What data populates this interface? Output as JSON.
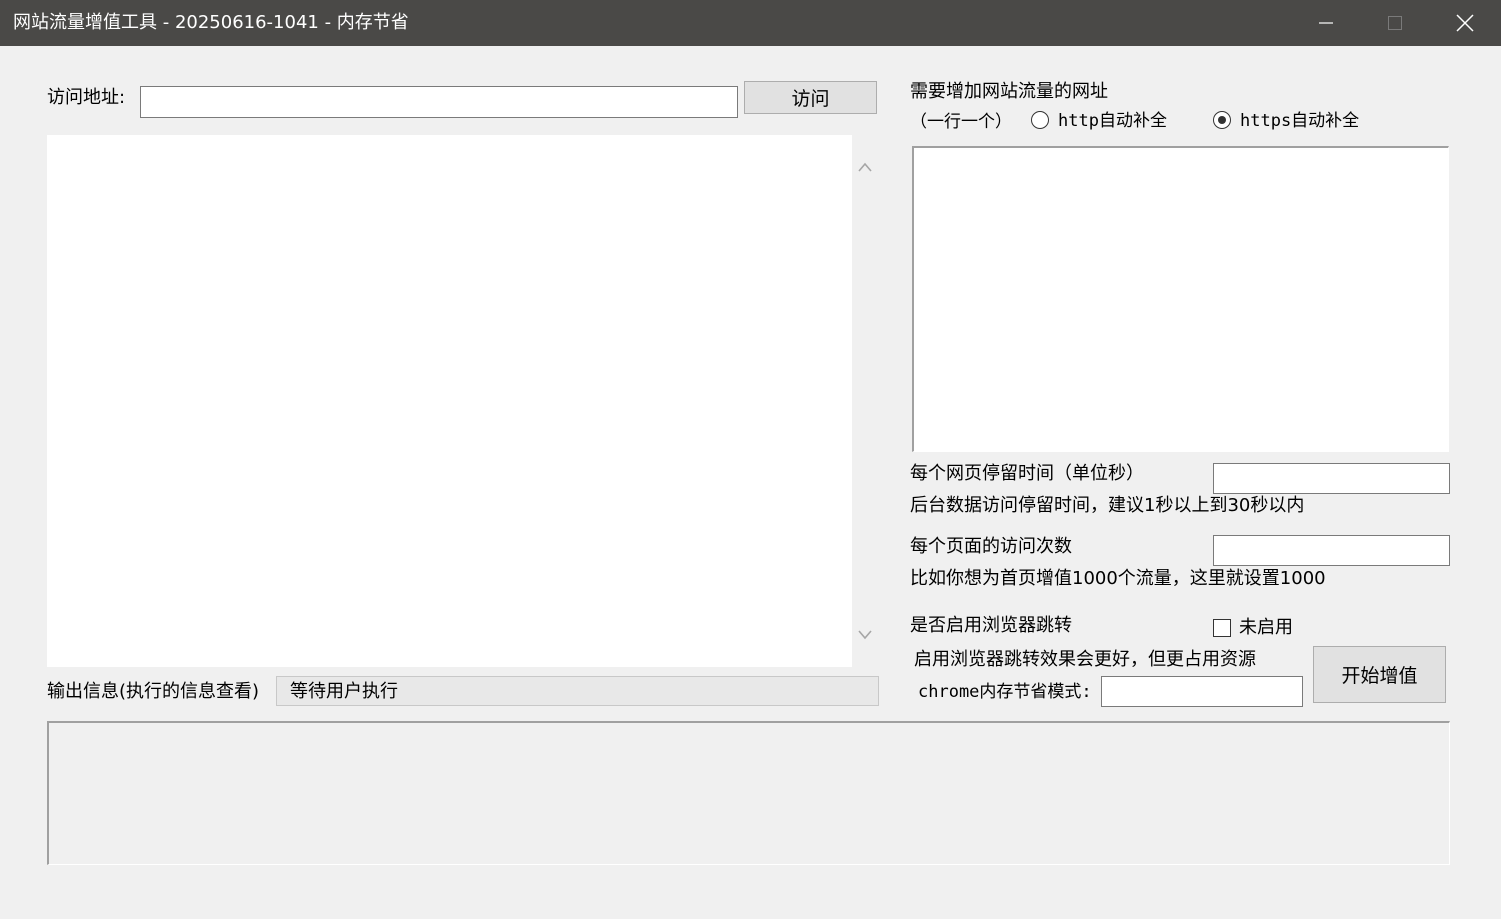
{
  "window": {
    "title": "网站流量增值工具 - 20250616-1041 - 内存节省",
    "icons": [
      "minimize-icon",
      "maximize-icon",
      "close-icon"
    ]
  },
  "visit": {
    "label": "访问地址:",
    "url_value": "",
    "button_label": "访问"
  },
  "urls_panel": {
    "heading": "需要增加网站流量的网址",
    "hint": "（一行一个）",
    "radio_http_label": "http自动补全",
    "radio_https_label": "https自动补全",
    "selected_radio": "https",
    "urls_value": ""
  },
  "stay_time": {
    "label": "每个网页停留时间（单位秒）",
    "value": "",
    "note": "后台数据访问停留时间，建议1秒以上到30秒以内"
  },
  "visit_count": {
    "label": "每个页面的访问次数",
    "value": "",
    "note": "比如你想为首页增值1000个流量，这里就设置1000"
  },
  "browser_jump": {
    "label": "是否启用浏览器跳转",
    "checkbox_label": "未启用",
    "checked": false,
    "note": "启用浏览器跳转效果会更好，但更占用资源"
  },
  "chrome_mode": {
    "label": "chrome内存节省模式:",
    "value": ""
  },
  "start_button_label": "开始增值",
  "output": {
    "label": "输出信息(执行的信息查看)",
    "status": "等待用户执行",
    "log": ""
  },
  "colors": {
    "titlebar_bg": "#4a4947",
    "window_bg": "#f0f0f0",
    "button_bg": "#e1e1e1"
  }
}
